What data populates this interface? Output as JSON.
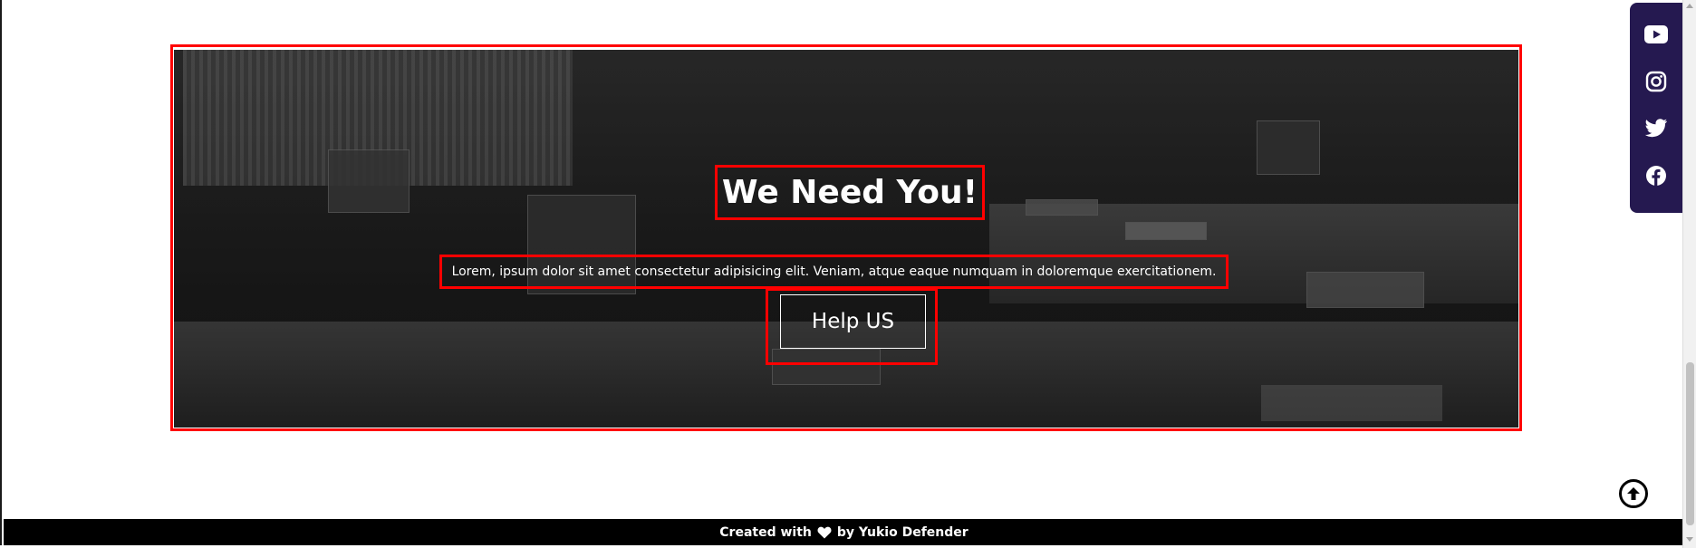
{
  "hero": {
    "title": "We Need You!",
    "description": "Lorem, ipsum dolor sit amet consectetur adipisicing elit. Veniam, atque eaque numquam in doloremque exercitationem.",
    "button_label": "Help US"
  },
  "social": [
    {
      "name": "youtube-icon"
    },
    {
      "name": "instagram-icon"
    },
    {
      "name": "twitter-icon"
    },
    {
      "name": "facebook-icon"
    }
  ],
  "footer": {
    "prefix": "Created with",
    "icon": "heart-icon",
    "suffix": "by Yukio Defender"
  },
  "colors": {
    "social_bg": "#251950",
    "highlight": "#ff0000",
    "footer_bg": "#000000"
  }
}
